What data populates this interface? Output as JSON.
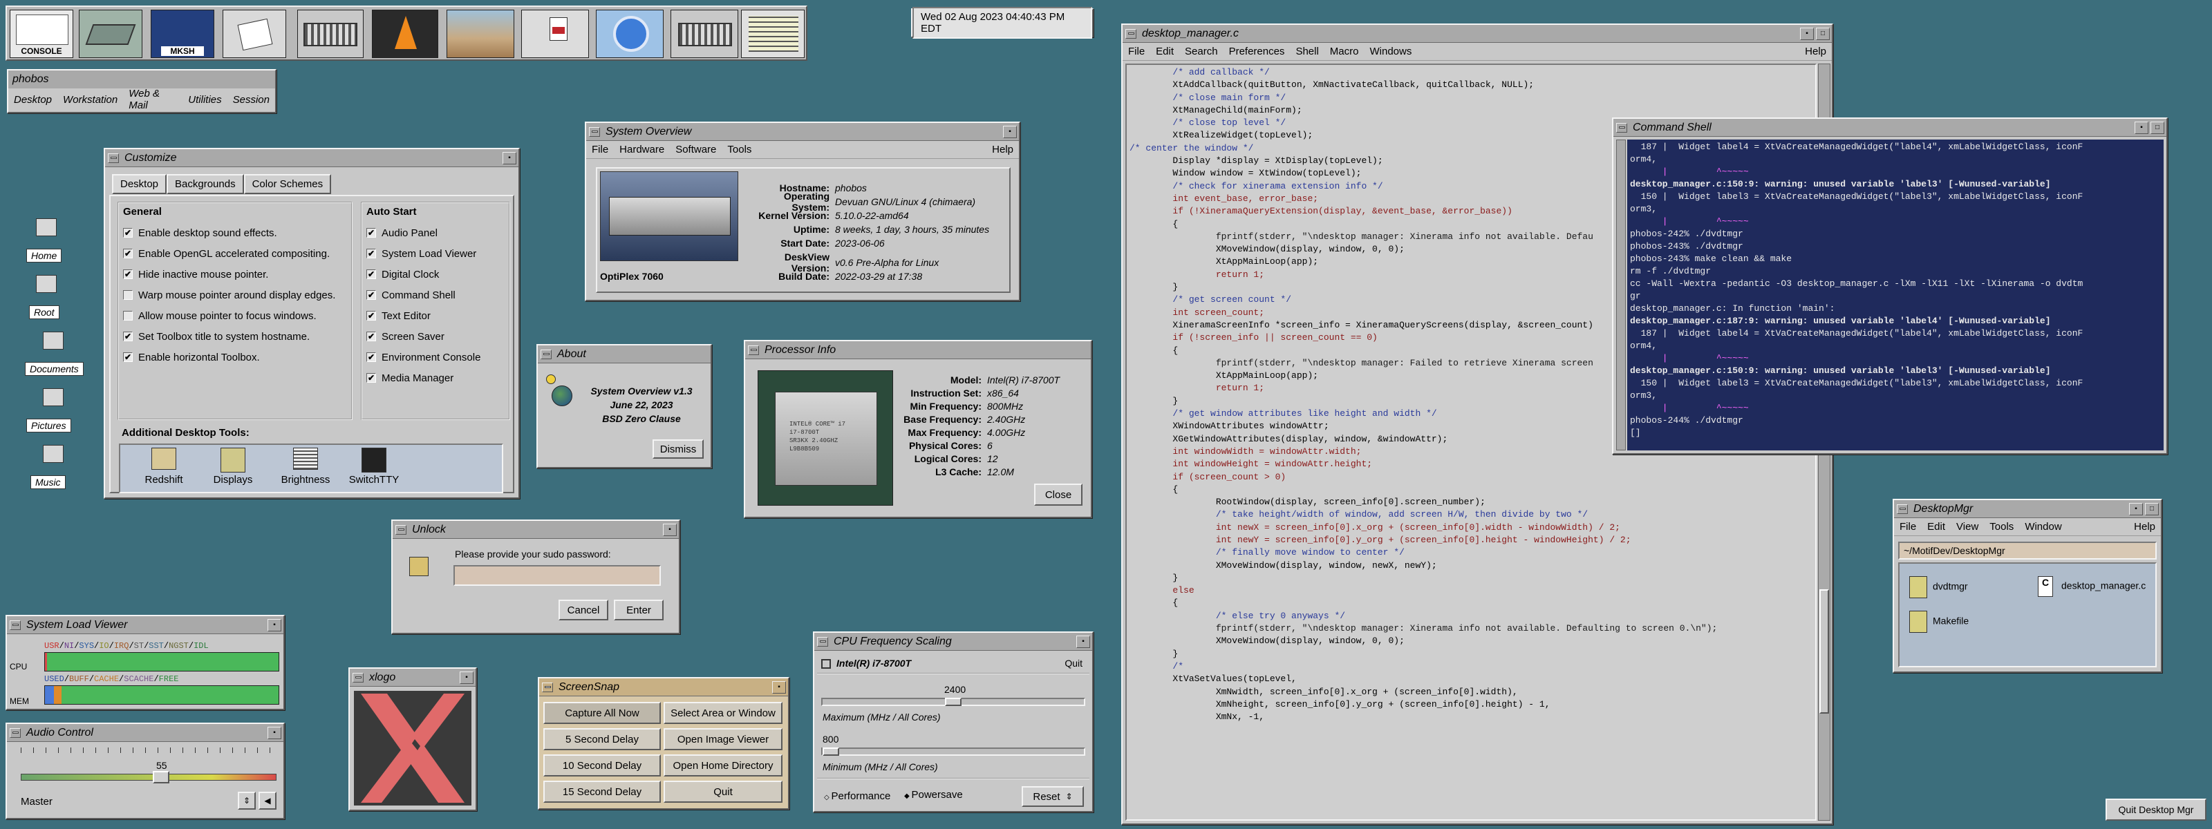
{
  "launcher": {
    "items": [
      "console-icon",
      "drive-icon",
      "mksh-icon",
      "editor-icon",
      "keyboard-icon",
      "vlc-icon",
      "desert-icon",
      "pdf-icon",
      "browser-icon",
      "keyboard2-icon",
      "grid-icon"
    ],
    "console_label": "CONSOLE",
    "mksh_label": "MKSH"
  },
  "clock": "Wed 02 Aug 2023 04:40:43 PM EDT",
  "hostmenu": {
    "title": "phobos",
    "items": [
      "Desktop",
      "Workstation",
      "Web & Mail",
      "Utilities",
      "Session"
    ]
  },
  "desktop_icons": [
    "Home",
    "Root",
    "Documents",
    "Pictures",
    "Music"
  ],
  "customize": {
    "title": "Customize",
    "tabs": [
      "Desktop",
      "Backgrounds",
      "Color Schemes"
    ],
    "general_title": "General",
    "general": [
      {
        "label": "Enable desktop sound effects.",
        "checked": true
      },
      {
        "label": "Enable OpenGL accelerated compositing.",
        "checked": true
      },
      {
        "label": "Hide inactive mouse pointer.",
        "checked": true
      },
      {
        "label": "Warp mouse pointer around display edges.",
        "checked": false
      },
      {
        "label": "Allow mouse pointer to focus windows.",
        "checked": false
      },
      {
        "label": "Set Toolbox title to system hostname.",
        "checked": true
      },
      {
        "label": "Enable horizontal Toolbox.",
        "checked": true
      }
    ],
    "autostart_title": "Auto Start",
    "autostart": [
      "Audio Panel",
      "System Load Viewer",
      "Digital Clock",
      "Command Shell",
      "Text Editor",
      "Screen Saver",
      "Environment Console",
      "Media Manager"
    ],
    "tools_title": "Additional Desktop Tools:",
    "tools": [
      "Redshift",
      "Displays",
      "Brightness",
      "SwitchTTY"
    ]
  },
  "sysov": {
    "title": "System Overview",
    "menu": [
      "File",
      "Hardware",
      "Software",
      "Tools"
    ],
    "help": "Help",
    "model": "OptiPlex 7060",
    "fields": [
      {
        "k": "Hostname:",
        "v": "phobos"
      },
      {
        "k": "Operating System:",
        "v": "Devuan GNU/Linux 4 (chimaera)"
      },
      {
        "k": "Kernel Version:",
        "v": "5.10.0-22-amd64"
      },
      {
        "k": "Uptime:",
        "v": "8 weeks, 1 day, 3 hours, 35 minutes"
      },
      {
        "k": "Start Date:",
        "v": "2023-06-06"
      }
    ],
    "fields2": [
      {
        "k": "DeskView Version:",
        "v": "v0.6 Pre-Alpha for Linux"
      },
      {
        "k": "Build Date:",
        "v": "2022-03-29 at 17:38"
      }
    ]
  },
  "about": {
    "title": "About",
    "l1": "System Overview v1.3",
    "l2": "June 22, 2023",
    "l3": "BSD Zero Clause",
    "dismiss": "Dismiss"
  },
  "proc": {
    "title": "Processor Info",
    "fields": [
      {
        "k": "Model:",
        "v": "Intel(R) i7-8700T"
      },
      {
        "k": "Instruction Set:",
        "v": "x86_64"
      },
      {
        "k": "Min Frequency:",
        "v": "800MHz"
      },
      {
        "k": "Base Frequency:",
        "v": "2.40GHz"
      },
      {
        "k": "Max Frequency:",
        "v": "4.00GHz"
      },
      {
        "k": "Physical Cores:",
        "v": "6"
      },
      {
        "k": "Logical Cores:",
        "v": "12"
      },
      {
        "k": "L3 Cache:",
        "v": "12.0M"
      }
    ],
    "close": "Close",
    "chip_lines": [
      "INTEL® CORE™ i7",
      "i7-8700T",
      "SR3KX 2.40GHZ",
      "L9B8B509"
    ]
  },
  "unlock": {
    "title": "Unlock",
    "prompt": "Please provide your sudo password:",
    "cancel": "Cancel",
    "enter": "Enter"
  },
  "sysload": {
    "title": "System Load Viewer",
    "cpu": "CPU",
    "mem": "MEM",
    "cpu_legend": [
      "USR",
      "NI",
      "SYS",
      "IO",
      "IRQ",
      "ST",
      "SST",
      "NGST",
      "IDL"
    ],
    "mem_legend": [
      "USED",
      "BUFF",
      "CACHE",
      "SCACHE",
      "FREE"
    ],
    "cpu_idle_fraction": 0.99,
    "mem_used_fraction": 0.07
  },
  "audio": {
    "title": "Audio Control",
    "value": "55",
    "channel": "Master",
    "level_fraction": 0.55
  },
  "xlogo": {
    "title": "xlogo"
  },
  "snap": {
    "title": "ScreenSnap",
    "buttons": [
      "Capture All Now",
      "Select Area or Window",
      "5 Second Delay",
      "Open Image Viewer",
      "10 Second Delay",
      "Open Home Directory",
      "15 Second Delay",
      "Quit"
    ]
  },
  "cpufreq": {
    "title": "CPU Frequency Scaling",
    "cpu": "Intel(R) i7-8700T",
    "quit": "Quit",
    "max_value": "2400",
    "max_label": "Maximum (MHz / All Cores)",
    "min_value": "800",
    "min_label": "Minimum (MHz / All Cores)",
    "performance": "Performance",
    "powersave": "Powersave",
    "reset": "Reset",
    "max_fraction": 0.5,
    "min_fraction": 0.0
  },
  "editor": {
    "title": "desktop_manager.c",
    "menu": [
      "File",
      "Edit",
      "Search",
      "Preferences",
      "Shell",
      "Macro",
      "Windows"
    ],
    "help": "Help",
    "lines": [
      "        /* add callback */",
      "        XtAddCallback(quitButton, XmNactivateCallback, quitCallback, NULL);",
      "",
      "        /* close main form */",
      "        XtManageChild(mainForm);",
      "        /* close top level */",
      "        XtRealizeWidget(topLevel);",
      "",
      "/* center the window */",
      "        Display *display = XtDisplay(topLevel);",
      "        Window window = XtWindow(topLevel);",
      "",
      "        /* check for xinerama extension info */",
      "        int event_base, error_base;",
      "        if (!XineramaQueryExtension(display, &event_base, &error_base))",
      "        {",
      "                fprintf(stderr, \"\\ndesktop manager: Xinerama info not available. Defau",
      "                XMoveWindow(display, window, 0, 0);",
      "                XtAppMainLoop(app);",
      "                return 1;",
      "        }",
      "",
      "        /* get screen count */",
      "        int screen_count;",
      "        XineramaScreenInfo *screen_info = XineramaQueryScreens(display, &screen_count)",
      "        if (!screen_info || screen_count == 0)",
      "        {",
      "                fprintf(stderr, \"\\ndesktop manager: Failed to retrieve Xinerama screen",
      "                XtAppMainLoop(app);",
      "                return 1;",
      "        }",
      "",
      "        /* get window attributes like height and width */",
      "        XWindowAttributes windowAttr;",
      "        XGetWindowAttributes(display, window, &windowAttr);",
      "        int windowWidth = windowAttr.width;",
      "        int windowHeight = windowAttr.height;",
      "",
      "        if (screen_count > 0)",
      "        {",
      "                RootWindow(display, screen_info[0].screen_number);",
      "",
      "                /* take height/width of window, add screen H/W, then divide by two */",
      "                int newX = screen_info[0].x_org + (screen_info[0].width - windowWidth) / 2;",
      "                int newY = screen_info[0].y_org + (screen_info[0].height - windowHeight) / 2;",
      "",
      "                /* finally move window to center */",
      "                XMoveWindow(display, window, newX, newY);",
      "        }",
      "",
      "        else",
      "        {",
      "                /* else try 0 anyways */",
      "                fprintf(stderr, \"\\ndesktop manager: Xinerama info not available. Defaulting to screen 0.\\n\");",
      "                XMoveWindow(display, window, 0, 0);",
      "        }",
      "",
      "        /*",
      "        XtVaSetValues(topLevel,",
      "                XmNwidth, screen_info[0].x_org + (screen_info[0].width),",
      "                XmNheight, screen_info[0].y_org + (screen_info[0].height) - 1,",
      "                XmNx, -1,"
    ]
  },
  "shell": {
    "title": "Command Shell",
    "lines": [
      "  187 |  Widget label4 = XtVaCreateManagedWidget(\"label4\", xmLabelWidgetClass, iconF",
      "orm4,",
      "      |         ^~~~~~",
      "desktop_manager.c:150:9: warning: unused variable 'label3' [-Wunused-variable]",
      "  150 |  Widget label3 = XtVaCreateManagedWidget(\"label3\", xmLabelWidgetClass, iconF",
      "orm3,",
      "      |         ^~~~~~",
      "phobos-242% ./dvdtmgr",
      "phobos-243% ./dvdtmgr",
      "phobos-243% make clean && make",
      "rm -f ./dvdtmgr",
      "cc -Wall -Wextra -pedantic -O3 desktop_manager.c -lXm -lX11 -lXt -lXinerama -o dvdtm",
      "gr",
      "desktop_manager.c: In function 'main':",
      "desktop_manager.c:187:9: warning: unused variable 'label4' [-Wunused-variable]",
      "  187 |  Widget label4 = XtVaCreateManagedWidget(\"label4\", xmLabelWidgetClass, iconF",
      "orm4,",
      "      |         ^~~~~~",
      "desktop_manager.c:150:9: warning: unused variable 'label3' [-Wunused-variable]",
      "  150 |  Widget label3 = XtVaCreateManagedWidget(\"label3\", xmLabelWidgetClass, iconF",
      "orm3,",
      "      |         ^~~~~~",
      "phobos-244% ./dvdtmgr",
      "[]"
    ]
  },
  "dmgr": {
    "title": "DesktopMgr",
    "menu": [
      "File",
      "Edit",
      "View",
      "Tools",
      "Window"
    ],
    "help": "Help",
    "path": "~/MotifDev/DesktopMgr",
    "files": [
      "dvdtmgr",
      "desktop_manager.c",
      "Makefile"
    ]
  },
  "quit_desktop": "Quit Desktop Mgr",
  "colors": {
    "desktop": "#3c6e7c",
    "window": "#c8c8c8",
    "shell_bg": "#1f2a5c",
    "accent": "#d8c8b4"
  }
}
